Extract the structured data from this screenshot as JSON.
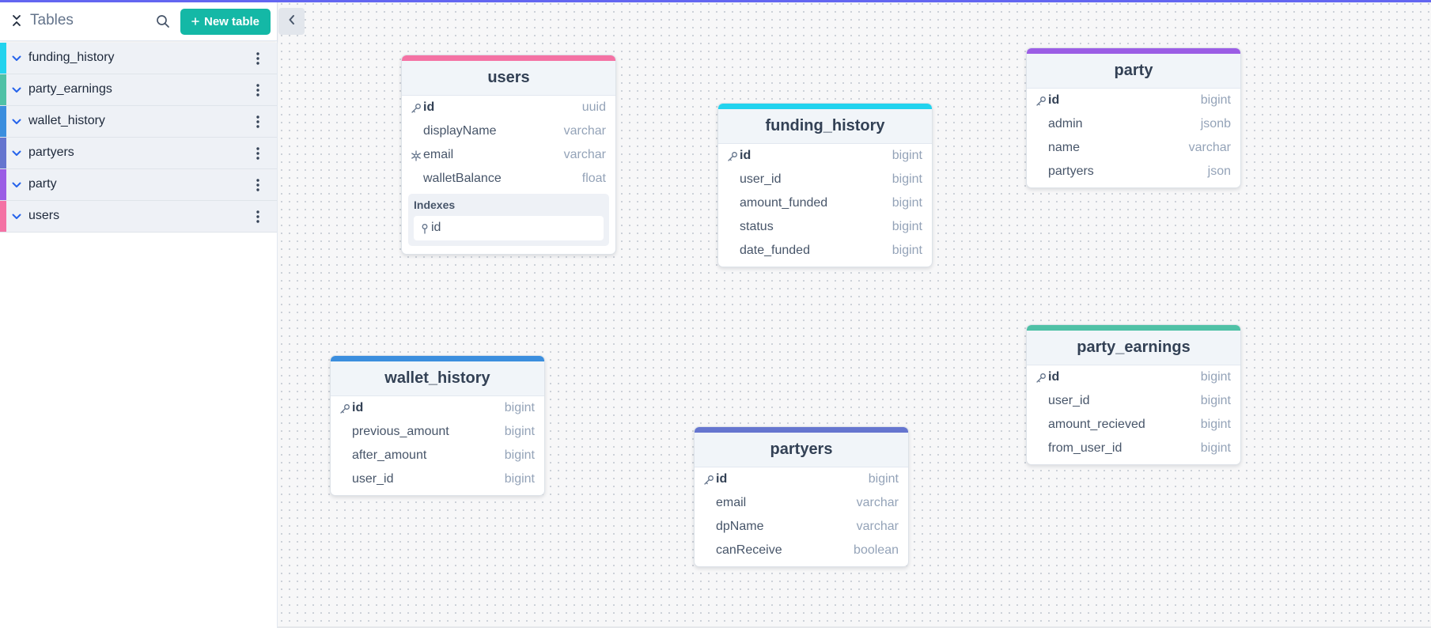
{
  "colors": {
    "accent": "#14b8a6",
    "top_line": "#6366f1",
    "funding_history": "#22d3ee",
    "party_earnings": "#4fc1a6",
    "wallet_history": "#3b8ede",
    "partyers": "#6575cf",
    "party": "#9b5de5",
    "users": "#f472a4"
  },
  "sidebar": {
    "title": "Tables",
    "new_table_label": "New table",
    "new_table_icon": "plus-icon",
    "items": [
      {
        "label": "funding_history",
        "color": "#22d3ee"
      },
      {
        "label": "party_earnings",
        "color": "#4fc1a6"
      },
      {
        "label": "wallet_history",
        "color": "#3b8ede"
      },
      {
        "label": "partyers",
        "color": "#6575cf"
      },
      {
        "label": "party",
        "color": "#9b5de5"
      },
      {
        "label": "users",
        "color": "#f472a4"
      }
    ]
  },
  "tables": {
    "users": {
      "name": "users",
      "color": "#f472a4",
      "fields": [
        {
          "name": "id",
          "type": "uuid",
          "icon": "key-icon"
        },
        {
          "name": "displayName",
          "type": "varchar"
        },
        {
          "name": "email",
          "type": "varchar",
          "icon": "unique-icon"
        },
        {
          "name": "walletBalance",
          "type": "float"
        }
      ],
      "indexes_title": "Indexes",
      "indexes": [
        {
          "name": "id"
        }
      ]
    },
    "funding_history": {
      "name": "funding_history",
      "color": "#22d3ee",
      "fields": [
        {
          "name": "id",
          "type": "bigint",
          "icon": "key-icon"
        },
        {
          "name": "user_id",
          "type": "bigint"
        },
        {
          "name": "amount_funded",
          "type": "bigint"
        },
        {
          "name": "status",
          "type": "bigint"
        },
        {
          "name": "date_funded",
          "type": "bigint"
        }
      ]
    },
    "party": {
      "name": "party",
      "color": "#9b5de5",
      "fields": [
        {
          "name": "id",
          "type": "bigint",
          "icon": "key-icon"
        },
        {
          "name": "admin",
          "type": "jsonb"
        },
        {
          "name": "name",
          "type": "varchar"
        },
        {
          "name": "partyers",
          "type": "json"
        }
      ]
    },
    "wallet_history": {
      "name": "wallet_history",
      "color": "#3b8ede",
      "fields": [
        {
          "name": "id",
          "type": "bigint",
          "icon": "key-icon"
        },
        {
          "name": "previous_amount",
          "type": "bigint"
        },
        {
          "name": "after_amount",
          "type": "bigint"
        },
        {
          "name": "user_id",
          "type": "bigint"
        }
      ]
    },
    "partyers": {
      "name": "partyers",
      "color": "#6575cf",
      "fields": [
        {
          "name": "id",
          "type": "bigint",
          "icon": "key-icon"
        },
        {
          "name": "email",
          "type": "varchar"
        },
        {
          "name": "dpName",
          "type": "varchar"
        },
        {
          "name": "canReceive",
          "type": "boolean"
        }
      ]
    },
    "party_earnings": {
      "name": "party_earnings",
      "color": "#4fc1a6",
      "fields": [
        {
          "name": "id",
          "type": "bigint",
          "icon": "key-icon"
        },
        {
          "name": "user_id",
          "type": "bigint"
        },
        {
          "name": "amount_recieved",
          "type": "bigint"
        },
        {
          "name": "from_user_id",
          "type": "bigint"
        }
      ]
    }
  }
}
